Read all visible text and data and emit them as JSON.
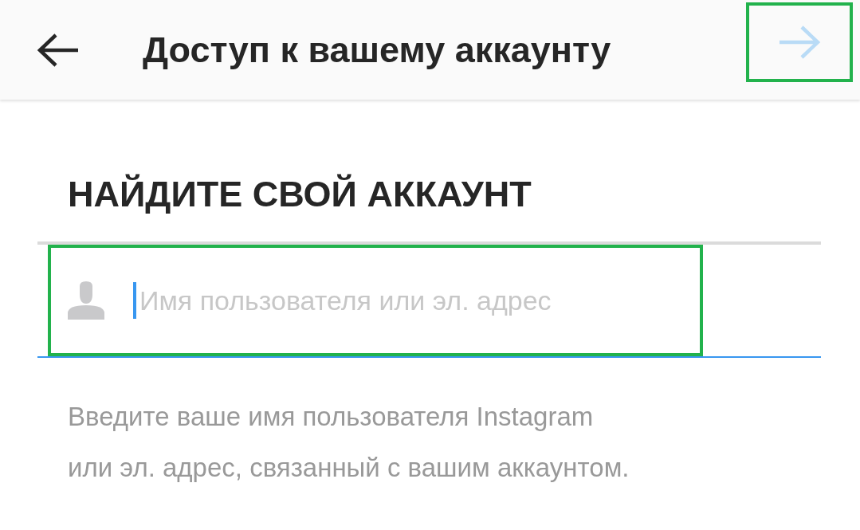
{
  "header": {
    "title": "Доступ к вашему аккаунту",
    "next_button": {
      "disabled": true,
      "highlighted": true
    }
  },
  "section_title": "НАЙДИТЕ СВОЙ АККАУНТ",
  "field": {
    "placeholder": "Имя пользователя или эл. адрес",
    "focused": true,
    "highlighted": true
  },
  "help_text": "Введите ваше имя пользователя Instagram\nили эл. адрес, связанный с вашим аккаунтом."
}
